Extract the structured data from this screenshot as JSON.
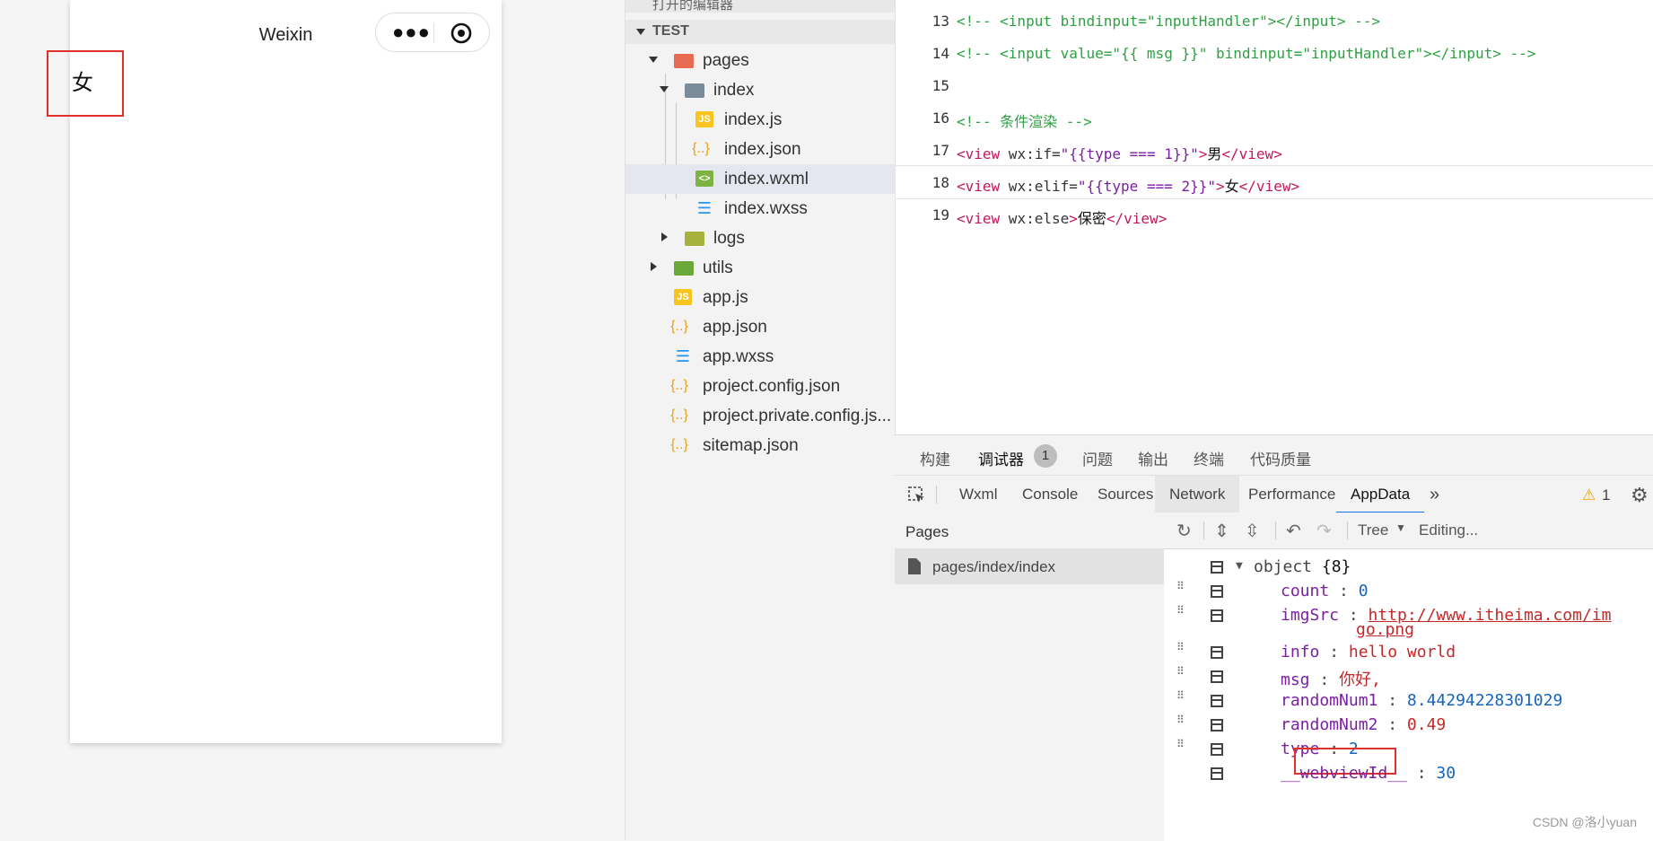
{
  "simulator": {
    "nav_title": "Weixin",
    "top_clip": "··· ···",
    "rendered_text": "女"
  },
  "explorer": {
    "top_clip": "打开的编辑器",
    "project": "TEST",
    "items": [
      {
        "label": "pages",
        "icon": "folder-red-icon"
      },
      {
        "label": "index",
        "icon": "folder-grey-icon"
      },
      {
        "label": "index.js",
        "icon": "js-file-icon"
      },
      {
        "label": "index.json",
        "icon": "json-file-icon"
      },
      {
        "label": "index.wxml",
        "icon": "wxml-file-icon"
      },
      {
        "label": "index.wxss",
        "icon": "wxss-file-icon"
      },
      {
        "label": "logs",
        "icon": "folder-olive-icon"
      },
      {
        "label": "utils",
        "icon": "folder-green-icon"
      },
      {
        "label": "app.js",
        "icon": "js-file-icon"
      },
      {
        "label": "app.json",
        "icon": "json-file-icon"
      },
      {
        "label": "app.wxss",
        "icon": "wxss-file-icon"
      },
      {
        "label": "project.config.json",
        "icon": "json-file-icon"
      },
      {
        "label": "project.private.config.js...",
        "icon": "json-file-icon"
      },
      {
        "label": "sitemap.json",
        "icon": "json-file-icon"
      }
    ],
    "selected": "index.wxml"
  },
  "editor": {
    "lines": [
      {
        "n": "13"
      },
      {
        "n": "14"
      },
      {
        "n": "15"
      },
      {
        "n": "16"
      },
      {
        "n": "17"
      },
      {
        "n": "18"
      },
      {
        "n": "19"
      }
    ],
    "l13": "<!-- <input bindinput=\"inputHandler\"></input> -->",
    "l14": "<!-- <input value=\"{{ msg }}\" bindinput=\"inputHandler\"></input> -->",
    "l16": "<!-- 条件渲染 -->",
    "l17": {
      "open": "<view",
      "attr": " wx:if=",
      "val": "\"{{type === 1}}\"",
      "gt": ">",
      "text": "男",
      "close": "</view>"
    },
    "l18": {
      "open": "<view",
      "attr": " wx:elif=",
      "val": "\"{{type === 2}}\"",
      "gt": ">",
      "text": "女",
      "close": "</view>"
    },
    "l19": {
      "open": "<view",
      "attr": " wx:else",
      "gt": ">",
      "text": "保密",
      "close": "</view>"
    }
  },
  "bottom": {
    "tabs": [
      "构建",
      "调试器",
      "问题",
      "输出",
      "终端",
      "代码质量"
    ],
    "debugger_badge": "1",
    "dev_tabs": [
      "Wxml",
      "Console",
      "Sources",
      "Network",
      "Performance",
      "AppData"
    ],
    "more": "»",
    "warning_count": "1",
    "pages_header": "Pages",
    "page_item": "pages/index/index",
    "toolbar": {
      "view_mode": "Tree",
      "editing": "Editing..."
    },
    "object_label": "object",
    "object_count": "{8}",
    "data": [
      {
        "key": "count",
        "value": "0"
      },
      {
        "key": "imgSrc",
        "value": "http://www.itheima.com/im",
        "value2": "go.png"
      },
      {
        "key": "info",
        "value": "hello world"
      },
      {
        "key": "msg",
        "value": "你好,"
      },
      {
        "key": "randomNum1",
        "value": "8.44294228301029"
      },
      {
        "key": "randomNum2",
        "value": "0.49"
      },
      {
        "key": "type",
        "value": "2"
      },
      {
        "key": "__webviewId__",
        "value": "30"
      }
    ]
  },
  "watermark": "CSDN @洛小yuan",
  "colors": {
    "highlight_red": "#e0302a",
    "accent_blue": "#1a73e8"
  }
}
